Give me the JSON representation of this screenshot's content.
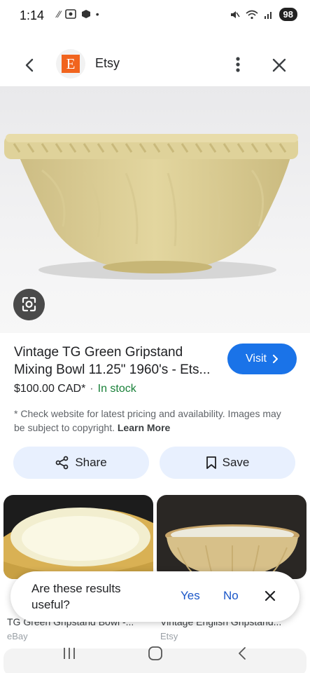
{
  "status_bar": {
    "time": "1:14",
    "left_icons": [
      "sync-icon",
      "screenshot-icon",
      "nfc-icon",
      "dot-icon"
    ],
    "right_icons": [
      "mute-icon",
      "wifi-icon",
      "signal-icon"
    ],
    "battery": "98"
  },
  "header": {
    "logo_letter": "E",
    "site_name": "Etsy",
    "icons": [
      "back-icon",
      "more-vert-icon",
      "close-icon"
    ]
  },
  "product": {
    "title": "Vintage TG Green Gripstand Mixing Bowl 11.25\" 1960's - Ets...",
    "price": "$100.00 CAD*",
    "separator": "·",
    "stock": "In stock",
    "visit_label": "Visit",
    "disclaimer": "* Check website for latest pricing and availability. Images may be subject to copyright.",
    "learn_more": "Learn More"
  },
  "actions": {
    "share_label": "Share",
    "save_label": "Save"
  },
  "related": [
    {
      "title": "TG Green Gripstand Bowl -...",
      "source": "eBay"
    },
    {
      "title": "Vintage English Gripstand...",
      "source": "Etsy"
    }
  ],
  "feedback": {
    "question": "Are these results useful?",
    "yes_label": "Yes",
    "no_label": "No"
  },
  "colors": {
    "accent": "#1a73e8",
    "stock_green": "#188038",
    "etsy_orange": "#f1641e",
    "chip_bg": "#e8f0fe"
  }
}
